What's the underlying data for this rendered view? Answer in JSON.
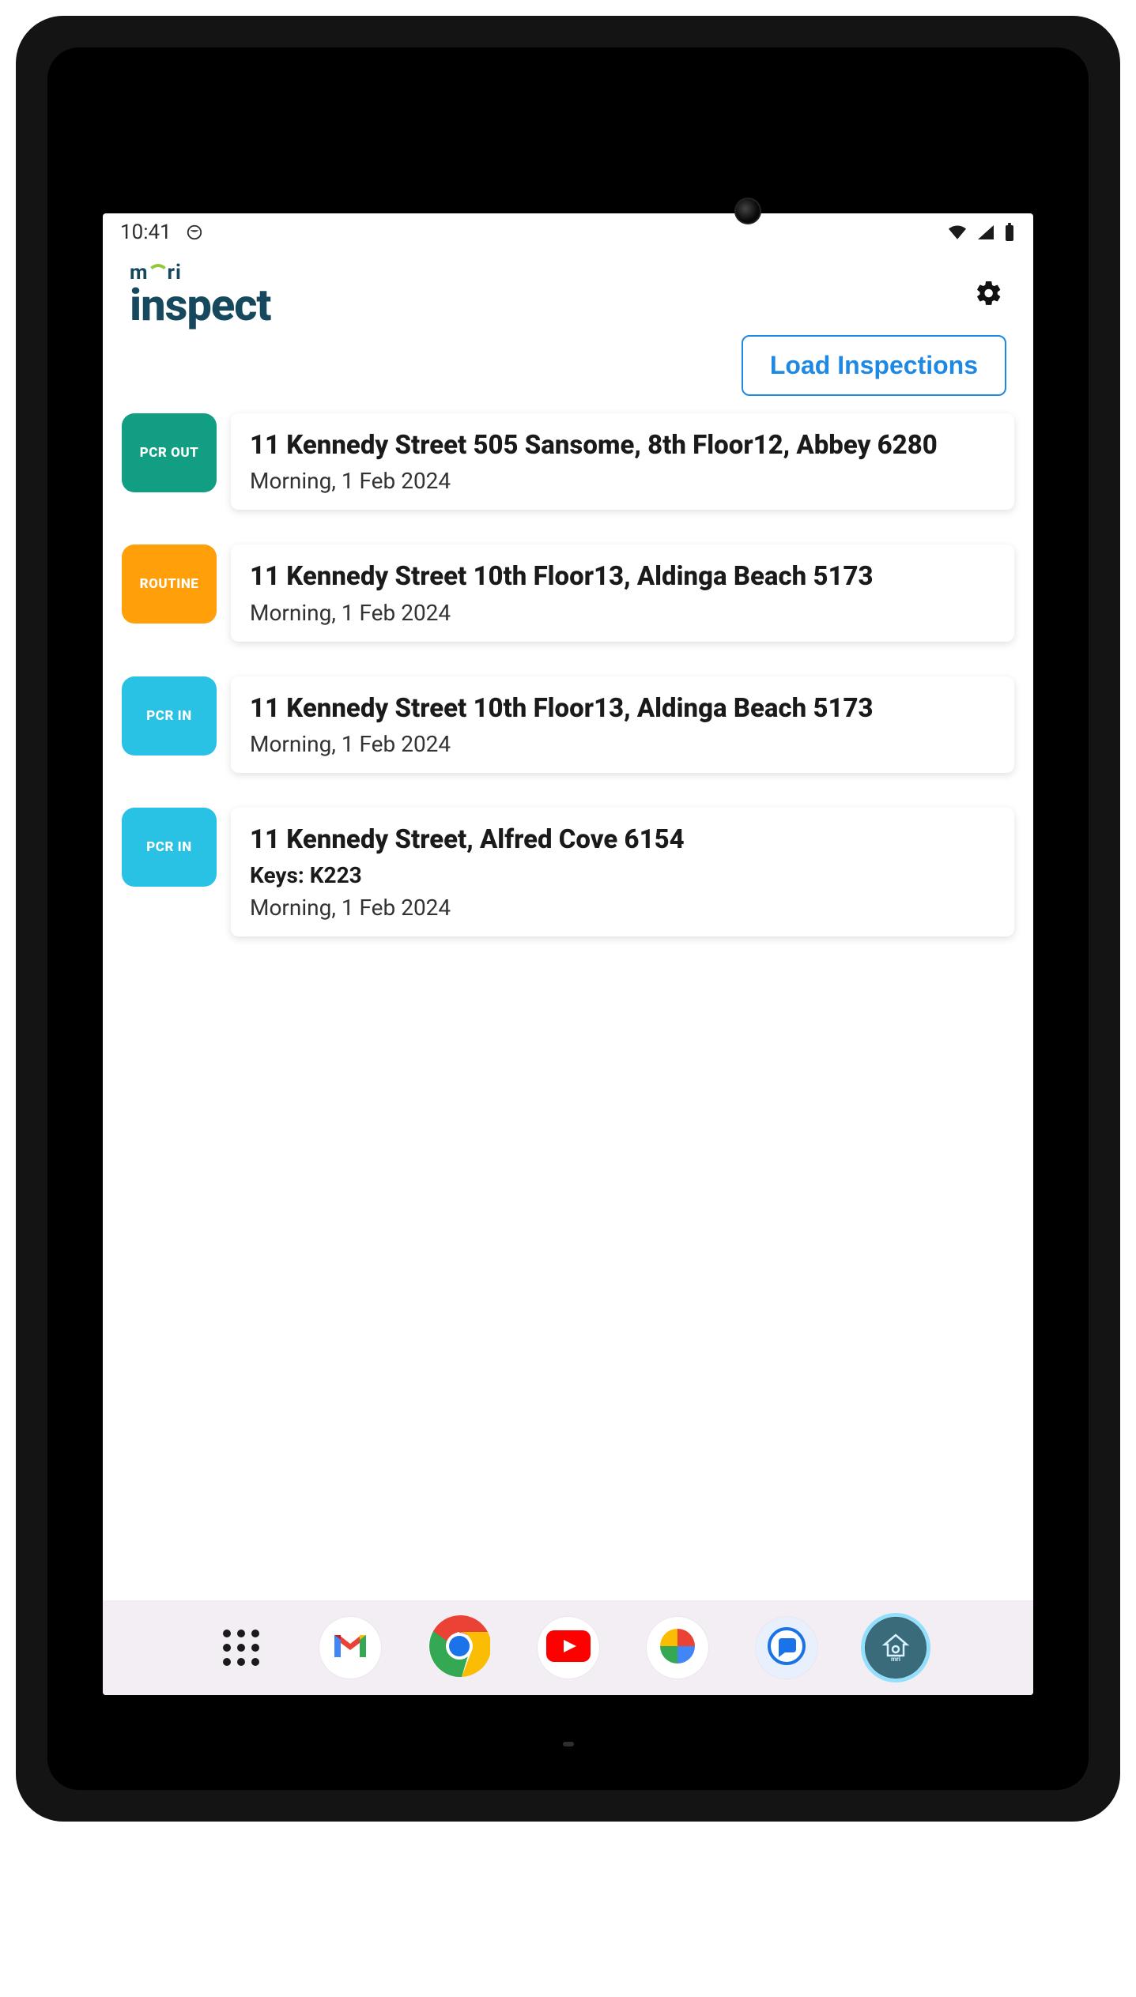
{
  "statusbar": {
    "time": "10:41"
  },
  "header": {
    "logo_small": "mri",
    "app_name": "inspect"
  },
  "toolbar": {
    "load_label": "Load Inspections"
  },
  "inspections": [
    {
      "type_label": "PCR OUT",
      "type_code": "pcr-out",
      "address": "11 Kennedy Street 505 Sansome, 8th Floor12, Abbey 6280",
      "keys": null,
      "datetime": "Morning, 1 Feb 2024"
    },
    {
      "type_label": "ROUTINE",
      "type_code": "routine",
      "address": "11 Kennedy Street 10th Floor13, Aldinga Beach 5173",
      "keys": null,
      "datetime": "Morning, 1 Feb 2024"
    },
    {
      "type_label": "PCR IN",
      "type_code": "pcr-in",
      "address": "11 Kennedy Street 10th Floor13, Aldinga Beach 5173",
      "keys": null,
      "datetime": "Morning, 1 Feb 2024"
    },
    {
      "type_label": "PCR IN",
      "type_code": "pcr-in",
      "address": "11 Kennedy Street, Alfred Cove 6154",
      "keys": "Keys: K223",
      "datetime": "Morning, 1 Feb 2024"
    }
  ],
  "dock": {
    "apps_drawer": "apps-drawer",
    "gmail": "gmail",
    "chrome": "chrome",
    "youtube": "youtube",
    "photos": "photos",
    "messages": "messages",
    "mri": "mri-inspect"
  },
  "colors": {
    "primary_blue": "#1e88e5",
    "pcr_out": "#119e82",
    "routine": "#ff9f0a",
    "pcr_in": "#29c1e4",
    "brand_text": "#16485e"
  }
}
